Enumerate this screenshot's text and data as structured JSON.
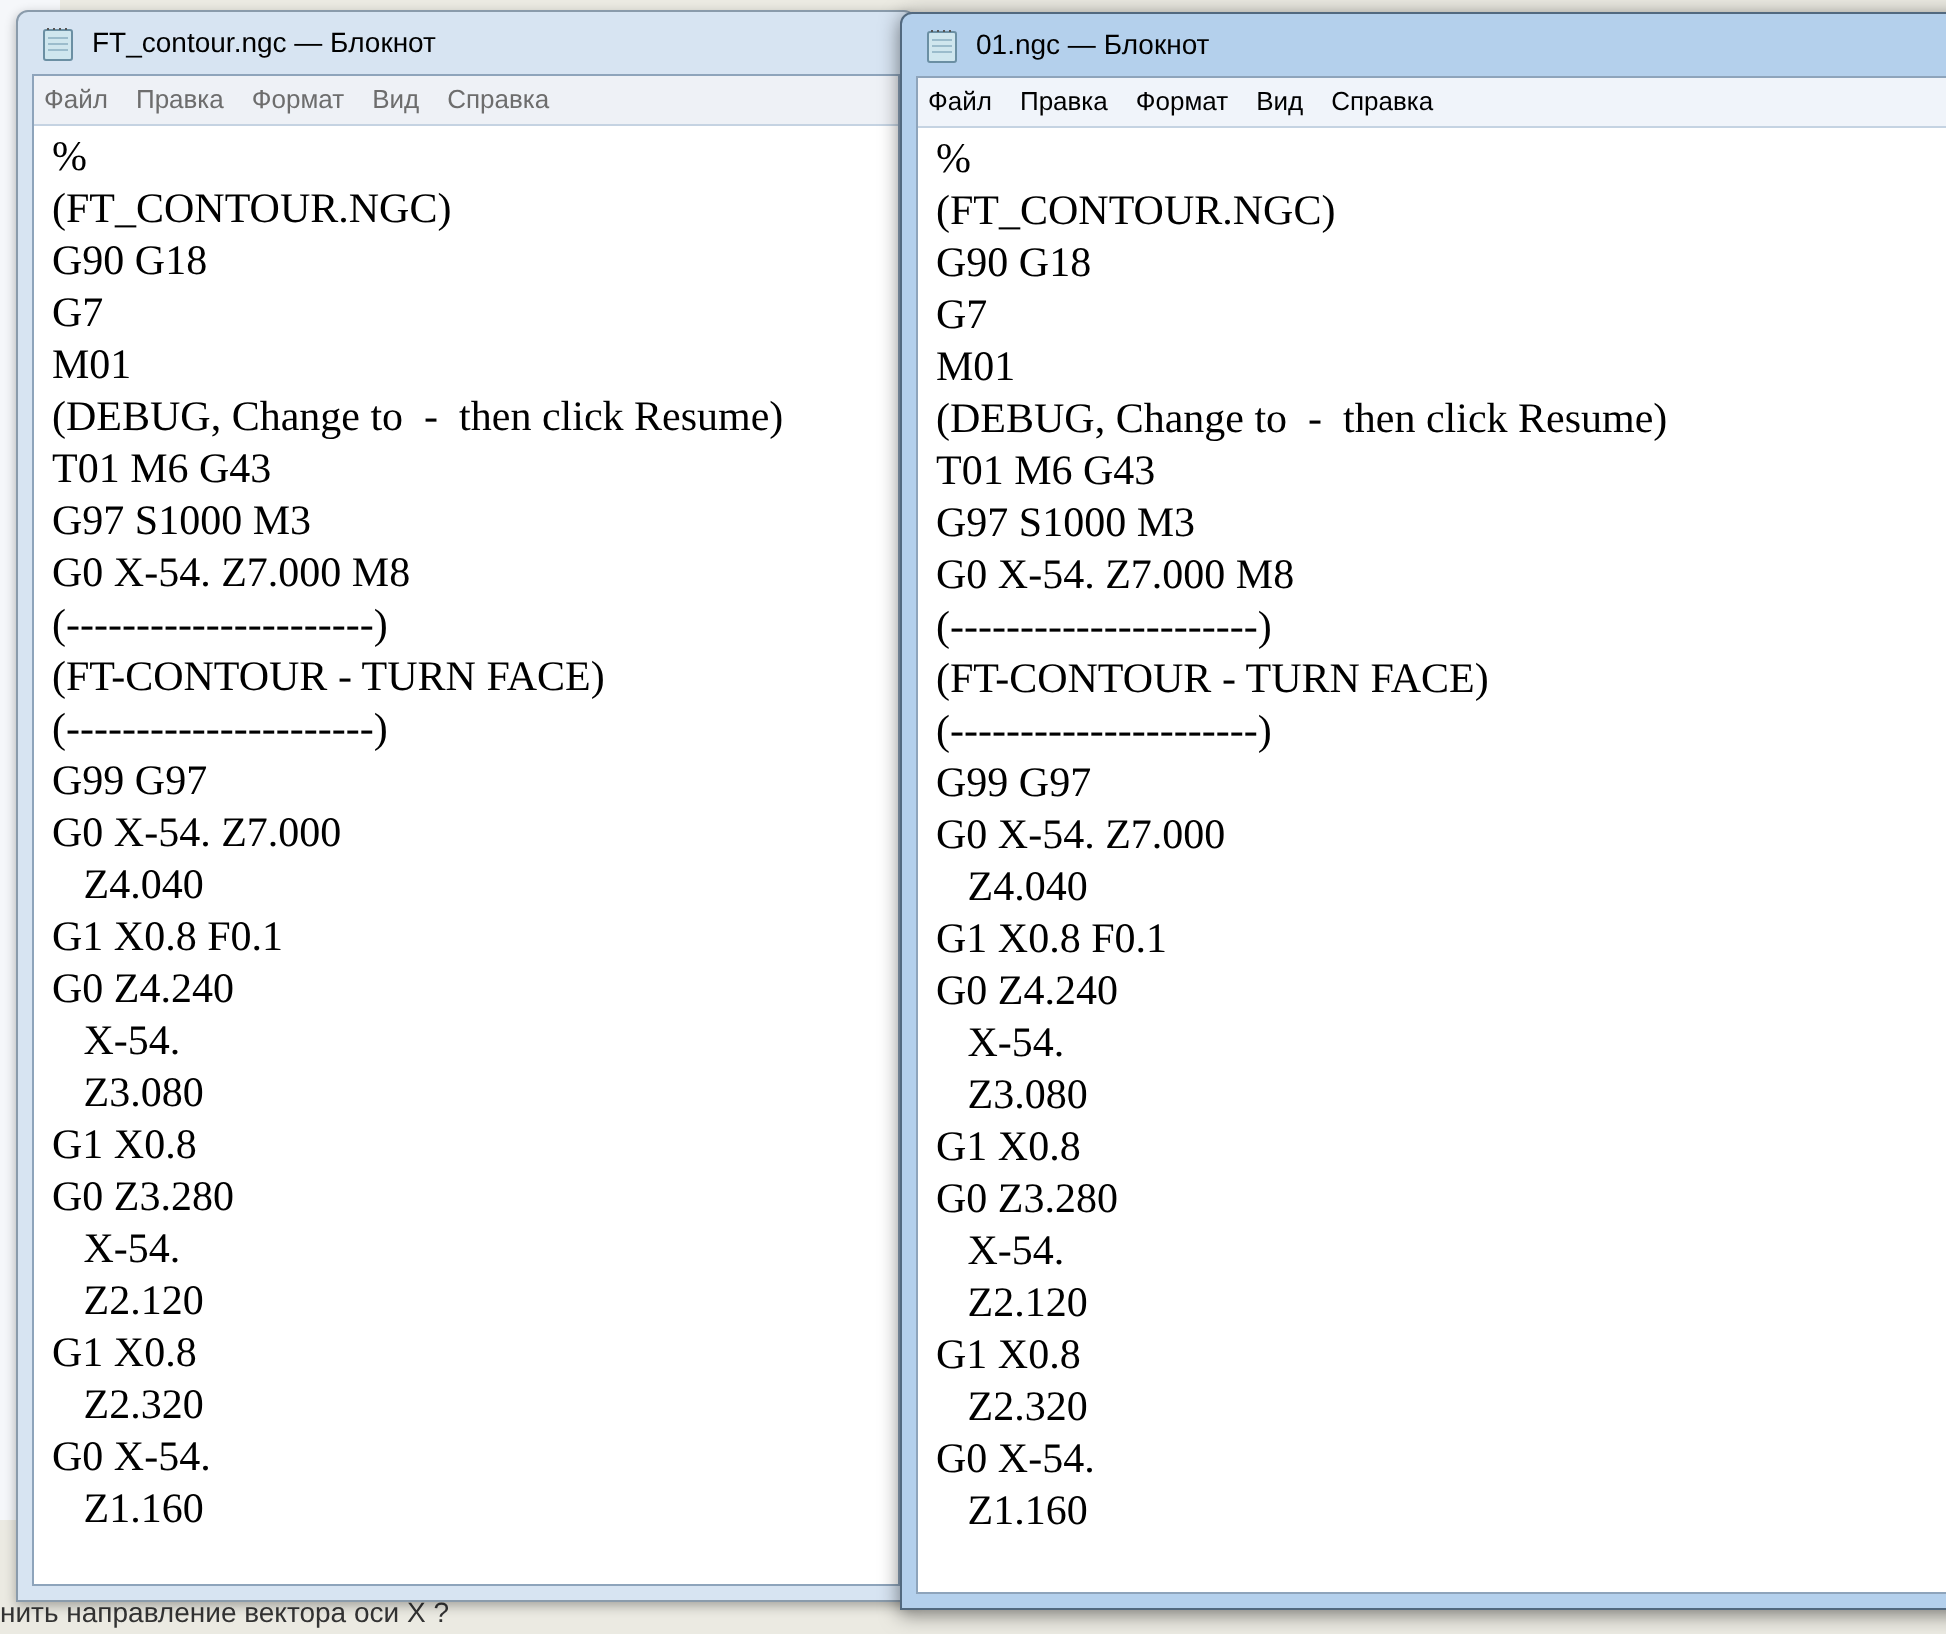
{
  "background_text": "нить направление вектора оси X ?",
  "windows": [
    {
      "title": "FT_contour.ngc — Блокнот",
      "active": false,
      "menu": [
        "Файл",
        "Правка",
        "Формат",
        "Вид",
        "Справка"
      ],
      "lines": [
        "%",
        "(FT_CONTOUR.NGC)",
        "G90 G18",
        "G7",
        "M01",
        "(DEBUG, Change to  -  then click Resume)",
        "T01 M6 G43",
        "G97 S1000 M3",
        "G0 X-54. Z7.000 M8",
        "(----------------------)",
        "(FT-CONTOUR - TURN FACE)",
        "(----------------------)",
        "G99 G97",
        "G0 X-54. Z7.000",
        "   Z4.040",
        "G1 X0.8 F0.1",
        "G0 Z4.240",
        "   X-54.",
        "   Z3.080",
        "G1 X0.8",
        "G0 Z3.280",
        "   X-54.",
        "   Z2.120",
        "G1 X0.8",
        "   Z2.320",
        "G0 X-54.",
        "   Z1.160"
      ]
    },
    {
      "title": "01.ngc — Блокнот",
      "active": true,
      "menu": [
        "Файл",
        "Правка",
        "Формат",
        "Вид",
        "Справка"
      ],
      "lines": [
        "%",
        "(FT_CONTOUR.NGC)",
        "G90 G18",
        "G7",
        "M01",
        "(DEBUG, Change to  -  then click Resume)",
        "T01 M6 G43",
        "G97 S1000 M3",
        "G0 X-54. Z7.000 M8",
        "(----------------------)",
        "(FT-CONTOUR - TURN FACE)",
        "(----------------------)",
        "G99 G97",
        "G0 X-54. Z7.000",
        "   Z4.040",
        "G1 X0.8 F0.1",
        "G0 Z4.240",
        "   X-54.",
        "   Z3.080",
        "G1 X0.8",
        "G0 Z3.280",
        "   X-54.",
        "   Z2.120",
        "G1 X0.8",
        "   Z2.320",
        "G0 X-54.",
        "   Z1.160"
      ]
    }
  ]
}
